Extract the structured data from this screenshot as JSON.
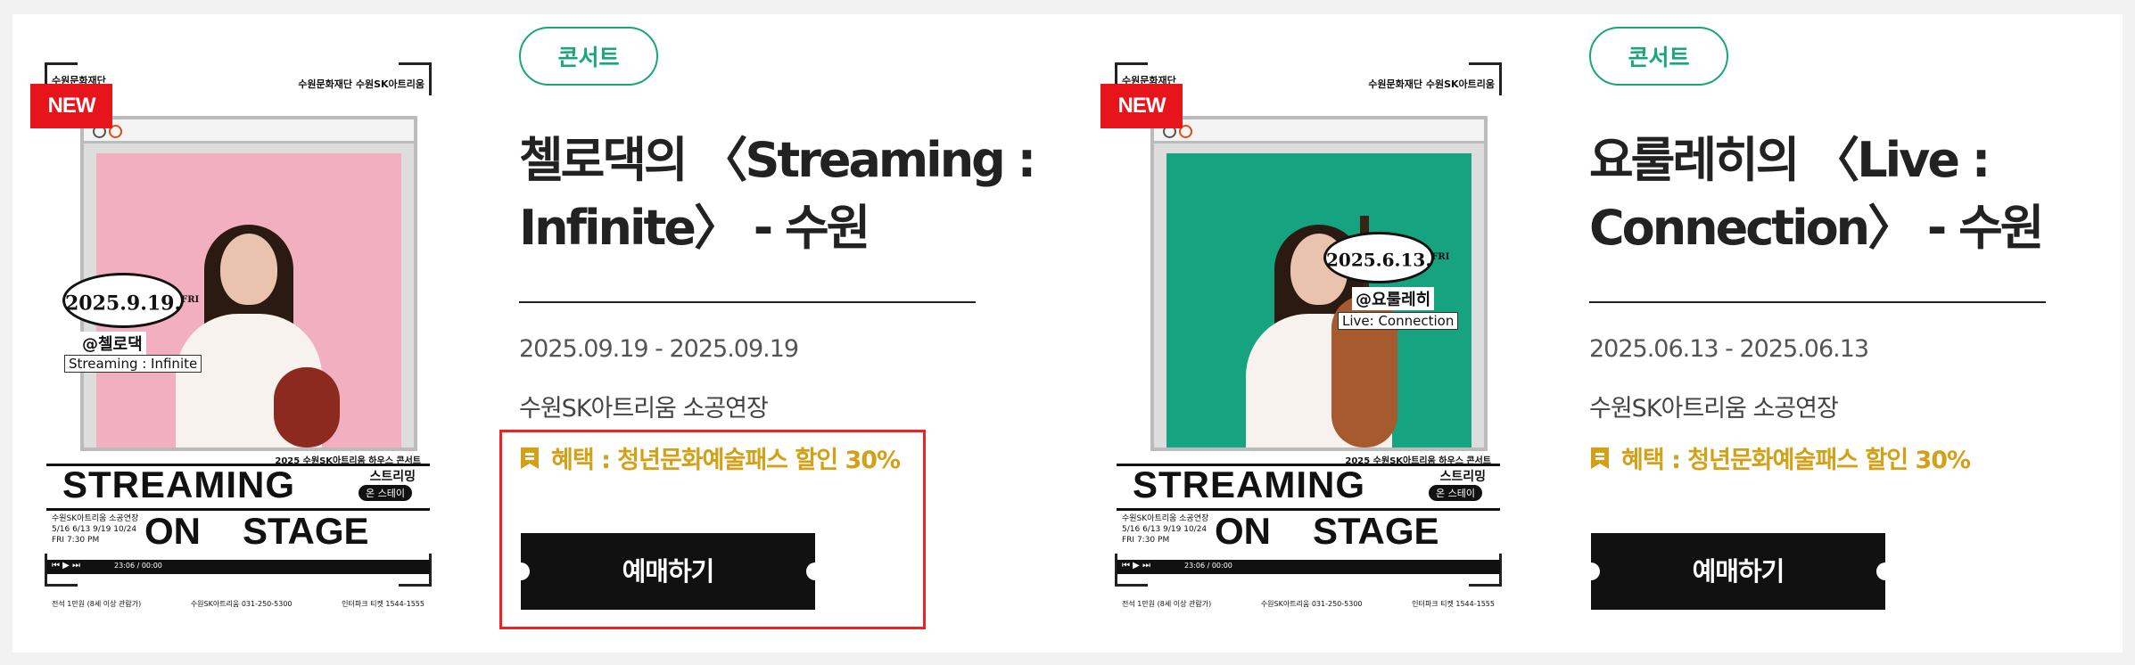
{
  "cards": [
    {
      "badge": "NEW",
      "category": "콘서트",
      "title_line1": "첼로댁의 〈Streaming :",
      "title_line2": "Infinite〉 - 수원",
      "date": "2025.09.19 - 2025.09.19",
      "venue": "수원SK아트리움 소공연장",
      "benefit": "혜택 : 청년문화예술패스 할인 30%",
      "button": "예매하기",
      "poster": {
        "date_text": "2025.9.19.",
        "date_day": "FRI",
        "handle": "@첼로댁",
        "subtitle": "Streaming : Infinite",
        "photo_bg": "#f2afc0"
      }
    },
    {
      "badge": "NEW",
      "category": "콘서트",
      "title_line1": "요룰레히의 〈Live :",
      "title_line2": "Connection〉 - 수원",
      "date": "2025.06.13 - 2025.06.13",
      "venue": "수원SK아트리움 소공연장",
      "benefit": "혜택 : 청년문화예술패스 할인 30%",
      "button": "예매하기",
      "poster": {
        "date_text": "2025.6.13.",
        "date_day": "FRI",
        "handle": "@요룰레히",
        "subtitle": "Live: Connection",
        "photo_bg": "#16a37f"
      }
    }
  ],
  "poster_common": {
    "top_left": "수원문화재단",
    "top_right": "수원문화재단  수원SK아트리움",
    "series": "2025 수원SK아트리움 하우스 콘서트",
    "stream_title": "STREAMING",
    "ko_label": "스트리밍",
    "ko_label2": "온 스테이",
    "on": "ON",
    "stage": "STAGE",
    "schedule_line1": "수원SK아트리움 소공연장",
    "schedule_line2": "5/16  6/13  9/19  10/24",
    "schedule_line3": "FRI  7:30 PM",
    "player_time": "23:06 / 00:00",
    "info1": "전석 1만원 (8세 이상 관람가)",
    "info2": "수원SK아트리움 031-250-5300",
    "info3": "인터파크 티켓 1544-1555"
  },
  "colors": {
    "tag_green": "#1aa57a",
    "benefit_gold": "#d4a017",
    "new_red": "#e8141b",
    "highlight_red": "#ee2222"
  }
}
